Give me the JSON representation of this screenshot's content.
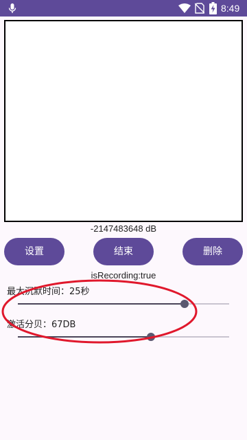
{
  "status_bar": {
    "time": "8:49",
    "icons": [
      "microphone-icon",
      "wifi-icon",
      "no-sim-icon",
      "battery-charging-icon"
    ]
  },
  "meter": {
    "db_text": "-2147483648 dB"
  },
  "buttons": {
    "settings": "设置",
    "stop": "结束",
    "delete": "删除"
  },
  "recording_status": "isRecording:true",
  "max_silence": {
    "label": "最大沉默时间：25秒",
    "value": 25,
    "level": 0.79
  },
  "activation_db": {
    "label": "激活分贝：67DB",
    "value": 67,
    "level": 0.63
  },
  "colors": {
    "accent": "#5e4a99",
    "annotation": "#e0182c",
    "background": "#fdf8fd"
  }
}
